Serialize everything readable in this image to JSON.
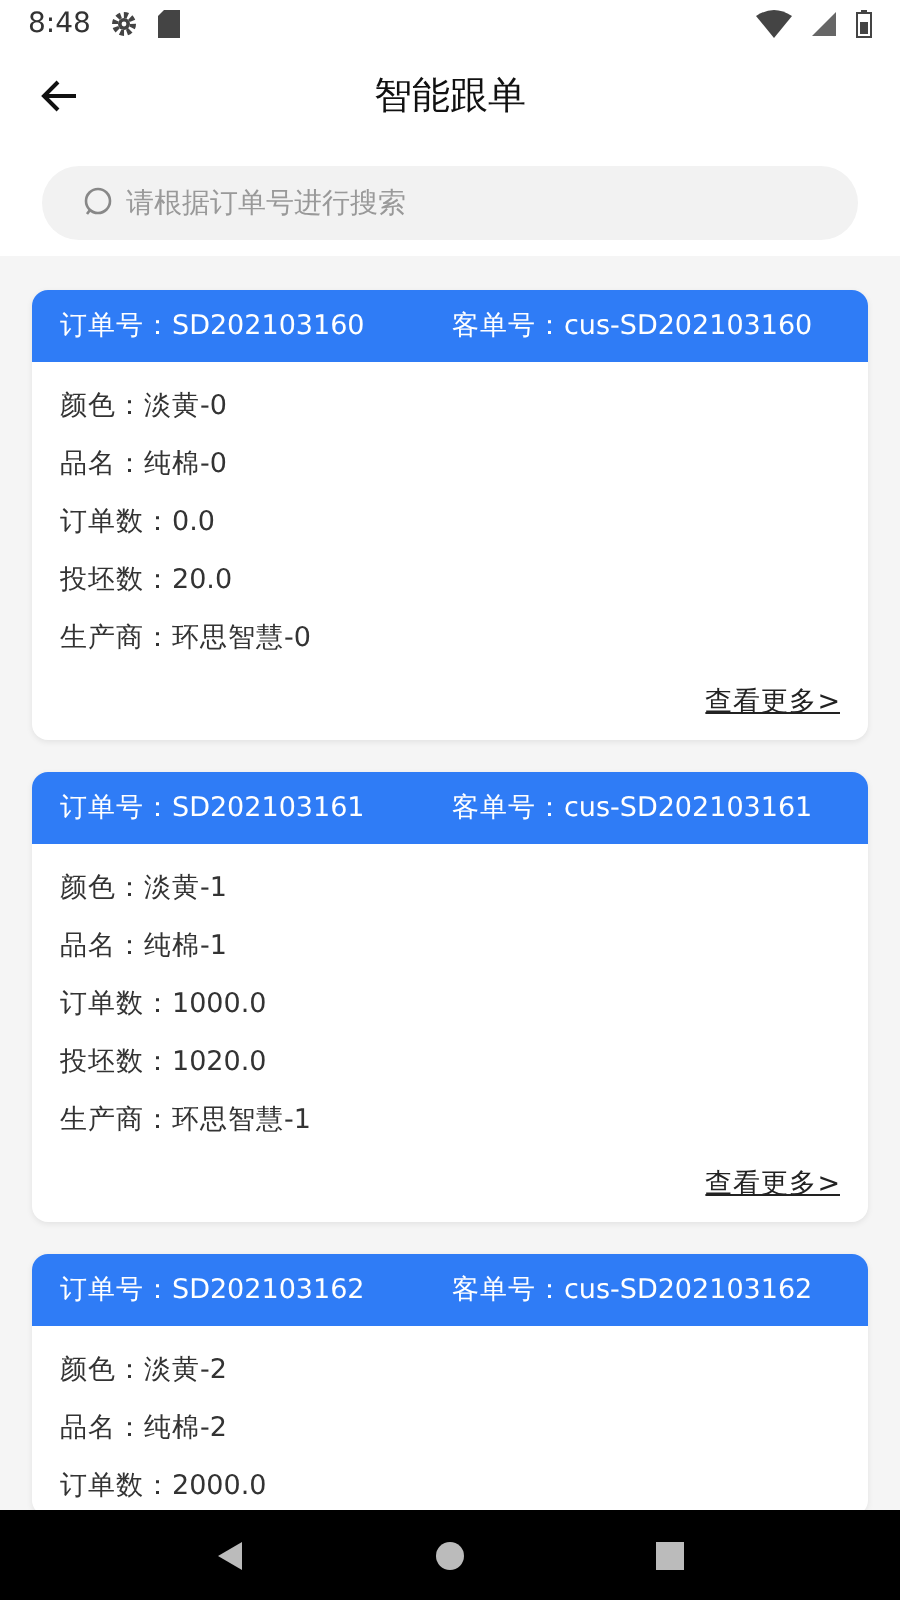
{
  "status_bar": {
    "time": "8:48"
  },
  "header": {
    "title": "智能跟单"
  },
  "search": {
    "placeholder": "请根据订单号进行搜索"
  },
  "orders": [
    {
      "order_no": "订单号：SD202103160",
      "customer_no": "客单号：cus-SD202103160",
      "fields": [
        "颜色：淡黄-0",
        "品名：纯棉-0",
        "订单数：0.0",
        "投坯数：20.0",
        "生产商：环思智慧-0"
      ],
      "more": "查看更多>"
    },
    {
      "order_no": "订单号：SD202103161",
      "customer_no": "客单号：cus-SD202103161",
      "fields": [
        "颜色：淡黄-1",
        "品名：纯棉-1",
        "订单数：1000.0",
        "投坯数：1020.0",
        "生产商：环思智慧-1"
      ],
      "more": "查看更多>"
    },
    {
      "order_no": "订单号：SD202103162",
      "customer_no": "客单号：cus-SD202103162",
      "fields": [
        "颜色：淡黄-2",
        "品名：纯棉-2",
        "订单数：2000.0"
      ]
    }
  ]
}
